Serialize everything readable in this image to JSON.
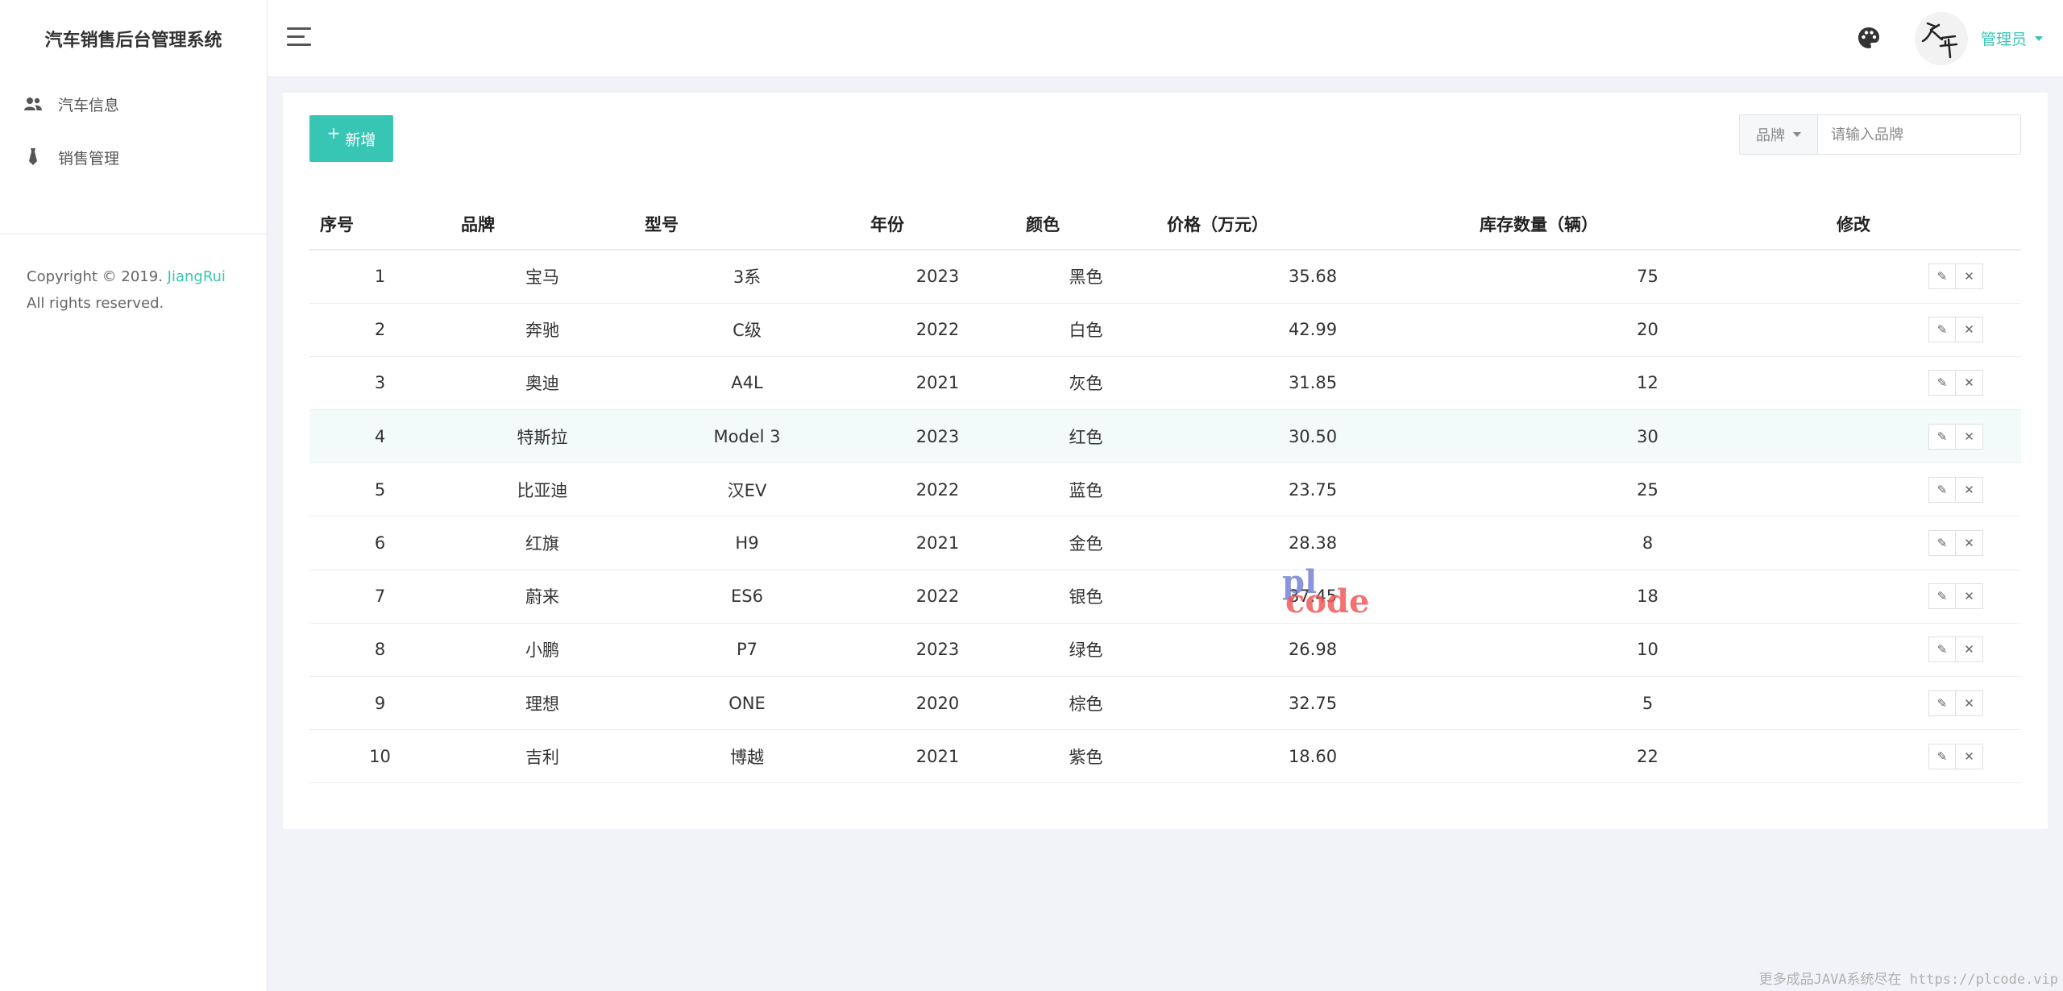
{
  "app": {
    "title": "汽车销售后台管理系统"
  },
  "sidebar": {
    "items": [
      {
        "label": "汽车信息",
        "icon": "users-icon"
      },
      {
        "label": "销售管理",
        "icon": "tie-icon"
      }
    ],
    "copyright": {
      "prefix": "Copyright © 2019. ",
      "link": "JiangRui",
      "suffix": " All rights reserved."
    }
  },
  "header": {
    "user_label": "管理员"
  },
  "toolbar": {
    "add_label": "新增",
    "add_icon": "+",
    "search_select": "品牌",
    "search_placeholder": "请输入品牌"
  },
  "table": {
    "columns": [
      "序号",
      "品牌",
      "型号",
      "年份",
      "颜色",
      "价格（万元）",
      "库存数量（辆）",
      "修改"
    ],
    "rows": [
      {
        "no": "1",
        "brand": "宝马",
        "model": "3系",
        "year": "2023",
        "color": "黑色",
        "price": "35.68",
        "stock": "75"
      },
      {
        "no": "2",
        "brand": "奔驰",
        "model": "C级",
        "year": "2022",
        "color": "白色",
        "price": "42.99",
        "stock": "20"
      },
      {
        "no": "3",
        "brand": "奥迪",
        "model": "A4L",
        "year": "2021",
        "color": "灰色",
        "price": "31.85",
        "stock": "12"
      },
      {
        "no": "4",
        "brand": "特斯拉",
        "model": "Model 3",
        "year": "2023",
        "color": "红色",
        "price": "30.50",
        "stock": "30"
      },
      {
        "no": "5",
        "brand": "比亚迪",
        "model": "汉EV",
        "year": "2022",
        "color": "蓝色",
        "price": "23.75",
        "stock": "25"
      },
      {
        "no": "6",
        "brand": "红旗",
        "model": "H9",
        "year": "2021",
        "color": "金色",
        "price": "28.38",
        "stock": "8"
      },
      {
        "no": "7",
        "brand": "蔚来",
        "model": "ES6",
        "year": "2022",
        "color": "银色",
        "price": "37.45",
        "stock": "18"
      },
      {
        "no": "8",
        "brand": "小鹏",
        "model": "P7",
        "year": "2023",
        "color": "绿色",
        "price": "26.98",
        "stock": "10"
      },
      {
        "no": "9",
        "brand": "理想",
        "model": "ONE",
        "year": "2020",
        "color": "棕色",
        "price": "32.75",
        "stock": "5"
      },
      {
        "no": "10",
        "brand": "吉利",
        "model": "博越",
        "year": "2021",
        "color": "紫色",
        "price": "18.60",
        "stock": "22"
      }
    ],
    "highlighted_row": 3,
    "edit_icon": "pencil-icon",
    "delete_icon": "close-icon",
    "edit_glyph": "✎",
    "delete_glyph": "✕"
  },
  "watermark": {
    "part1": "pl",
    "part2": "code"
  },
  "footer_note": "更多成品JAVA系统尽在 https://plcode.vip",
  "colors": {
    "accent": "#38c6b4",
    "background": "#f1f3f8",
    "highlight_row": "#f3fafa"
  }
}
